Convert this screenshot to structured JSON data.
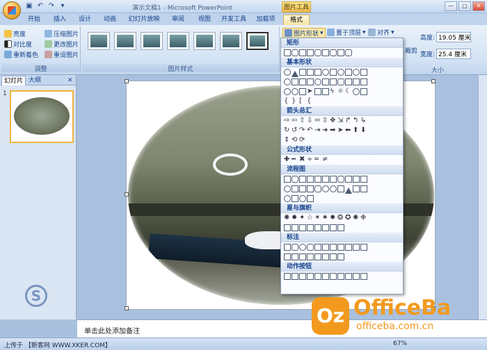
{
  "window": {
    "title": "演示文稿1 - Microsoft PowerPoint",
    "contextual_tab_group": "图片工具"
  },
  "tabs": [
    "开始",
    "插入",
    "设计",
    "动画",
    "幻灯片放映",
    "审阅",
    "视图",
    "开发工具",
    "加载项",
    "格式"
  ],
  "active_tab": "格式",
  "ribbon": {
    "adjust": {
      "label": "调整",
      "brightness": "亮度",
      "contrast": "对比度",
      "recolor": "重新着色",
      "compress": "压缩图片",
      "change": "更改图片",
      "reset": "重设图片"
    },
    "picture_styles": {
      "label": "图片样式"
    },
    "arrange": {
      "shape": "图片形状",
      "bring_front": "置于顶层",
      "align": "对齐"
    },
    "size": {
      "label": "大小",
      "height_label": "高度:",
      "height_value": "19.05 厘米",
      "width_label": "宽度:",
      "width_value": "25.4 厘米",
      "crop": "裁剪"
    }
  },
  "left_panel": {
    "tab_slides": "幻灯片",
    "tab_outline": "大纲",
    "slide_number": "1"
  },
  "shapes_menu": {
    "sections": [
      "矩形",
      "基本形状",
      "箭头总汇",
      "公式形状",
      "流程图",
      "星与旗帜",
      "标注",
      "动作按钮"
    ]
  },
  "notes": {
    "placeholder": "单击此处添加备注"
  },
  "status": {
    "text": "上传于 【新客网 WWW.XKER.COM】",
    "zoom": "67%"
  },
  "logo": {
    "icon_text": "Oz",
    "name": "OfficeBa",
    "url": "officeba.com.cn"
  },
  "watermark": {
    "symbol": "S"
  },
  "colors": {
    "ribbon_blue": "#d4e3f4",
    "accent_orange": "#f39a1e",
    "context_yellow": "#f7e4a4"
  }
}
